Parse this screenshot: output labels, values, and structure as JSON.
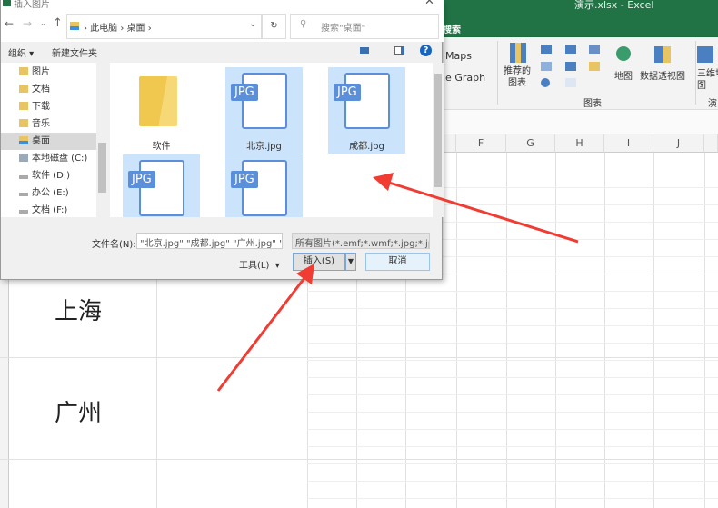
{
  "excel": {
    "title": "演示.xlsx  -  Excel",
    "search_label": "搜索",
    "ribbon": {
      "maps": "Maps",
      "people_graph": "le Graph",
      "recommended_charts": "推荐的\n图表",
      "map": "地图",
      "pivot_chart": "数据透视图",
      "three_d_map": "三维地\n图",
      "group_charts": "图表",
      "group_tours": "演示"
    },
    "columns": [
      "F",
      "G",
      "H",
      "I",
      "J"
    ],
    "cells": [
      "上海",
      "广州"
    ]
  },
  "dialog": {
    "title": "插入图片",
    "breadcrumb": [
      "此电脑",
      "桌面"
    ],
    "search_placeholder": "搜索\"桌面\"",
    "organize": "组织",
    "new_folder": "新建文件夹",
    "nav": [
      "图片",
      "文档",
      "下载",
      "音乐",
      "桌面",
      "本地磁盘 (C:)",
      "软件 (D:)",
      "办公 (E:)",
      "文档 (F:)"
    ],
    "nav_selected": "桌面",
    "files": [
      {
        "name": "软件",
        "type": "folder",
        "selected": false
      },
      {
        "name": "北京.jpg",
        "type": "jpg",
        "selected": true
      },
      {
        "name": "成都.jpg",
        "type": "jpg",
        "selected": true
      },
      {
        "name": "",
        "type": "jpg",
        "selected": true
      },
      {
        "name": "",
        "type": "jpg",
        "selected": true
      }
    ],
    "jpg_badge": "JPG",
    "filename_label": "文件名(N):",
    "filename_value": "\"北京.jpg\" \"成都.jpg\" \"广州.jpg\" \"",
    "filter": "所有图片(*.emf;*.wmf;*.jpg;*.jp",
    "tools": "工具(L)",
    "insert": "插入(S)",
    "cancel": "取消"
  },
  "colors": {
    "excel_green": "#217346",
    "selection": "#cce4fb",
    "jpg_blue": "#5b8fd9",
    "arrow": "#f03c32"
  }
}
